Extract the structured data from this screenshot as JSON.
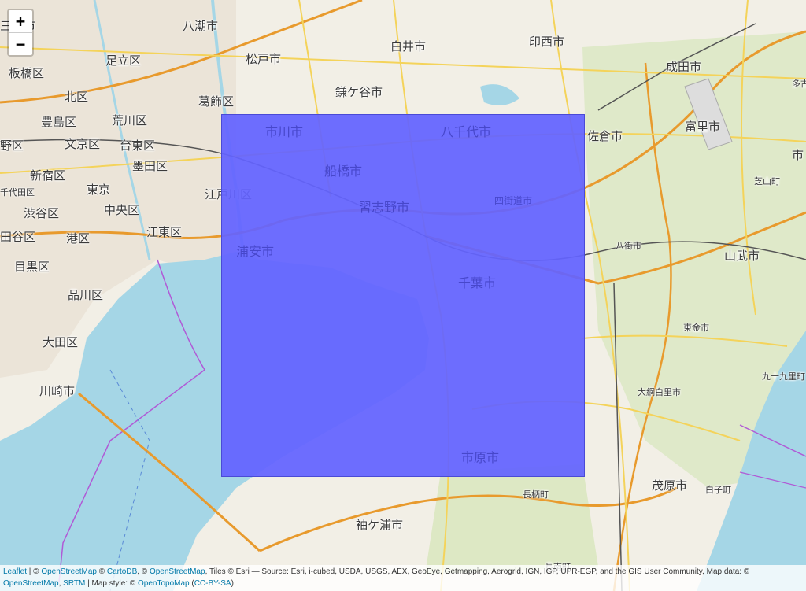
{
  "map": {
    "zoom_in_label": "+",
    "zoom_out_label": "−",
    "colors": {
      "water": "#a5d6e6",
      "land": "#f2efe6",
      "highway": "#e89a2d",
      "road": "#f4d35a",
      "rail": "#555555",
      "boundary": "#b05ad6",
      "overlay": "#6363ff"
    },
    "places": {
      "itabashi": "板橋区",
      "kita": "北区",
      "adachi": "足立区",
      "katsushika": "葛飾区",
      "toshima": "豊島区",
      "arakawa": "荒川区",
      "nakano": "野区",
      "bunkyo": "文京区",
      "taito": "台東区",
      "shinjuku": "新宿区",
      "sumida": "墨田区",
      "chiyoda": "千代田区",
      "tokyo": "東京",
      "shibuya": "渋谷区",
      "chuo": "中央区",
      "edogawa": "江戸川区",
      "minato": "港区",
      "koto": "江東区",
      "setagaya": "田谷区",
      "meguro": "目黒区",
      "urayasu": "浦安市",
      "shinagawa": "品川区",
      "ota": "大田区",
      "kawasaki": "川崎市",
      "misato": "三郷市",
      "yashio": "八潮市",
      "matsudo": "松戸市",
      "shiroi": "白井市",
      "inzai": "印西市",
      "narita": "成田市",
      "kamagaya": "鎌ケ谷市",
      "tomisato": "富里市",
      "sakura": "佐倉市",
      "shibayama": "芝山町",
      "yachimata": "八街市",
      "sammu": "山武市",
      "togane": "東金市",
      "kujukuri": "九十九里町",
      "oamishirasato": "大網白里市",
      "mobara": "茂原市",
      "shirako": "白子町",
      "chonan": "長柄町",
      "sodegaura": "袖ケ浦市",
      "nagara": "長南町",
      "ichikawa": "市川市",
      "yachiyo": "八千代市",
      "funabashi": "船橋市",
      "narashino": "習志野市",
      "yotsukaido": "四街道市",
      "chiba": "千葉市",
      "ichihara": "市原市",
      "edge_ta": "多古",
      "edge_shi": "市"
    },
    "attribution": {
      "leaflet": "Leaflet",
      "sep1": " | © ",
      "osm1": "OpenStreetMap",
      "sep2": " © ",
      "carto": "CartoDB",
      "sep3": ", © ",
      "osm2": "OpenStreetMap",
      "tiles": ", Tiles © Esri — Source: Esri, i-cubed, USDA, USGS, AEX, GeoEye, Getmapping, Aerogrid, IGN, IGP, UPR-EGP, and the GIS User Community, Map data: © ",
      "osm3": "OpenStreetMap",
      "sep4": ", ",
      "srtm": "SRTM",
      "style": " | Map style: © ",
      "otm": "OpenTopoMap",
      "sep5": " (",
      "license": "CC-BY-SA",
      "close": ")"
    }
  }
}
